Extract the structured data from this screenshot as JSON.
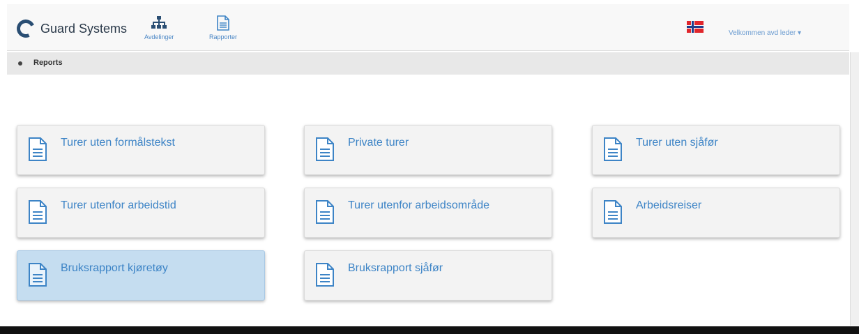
{
  "header": {
    "brand": "Guard Systems",
    "nav": [
      {
        "label": "Avdelinger",
        "icon": "org-chart-icon"
      },
      {
        "label": "Rapporter",
        "icon": "document-icon"
      }
    ],
    "language_flag": "norway-flag-icon",
    "welcome": "Velkommen avd leder"
  },
  "breadcrumb": {
    "label": "Reports"
  },
  "reports": [
    {
      "label": "Turer uten formålstekst"
    },
    {
      "label": "Private turer"
    },
    {
      "label": "Turer uten sjåfør"
    },
    {
      "label": "Turer utenfor arbeidstid"
    },
    {
      "label": "Turer utenfor arbeidsområde"
    },
    {
      "label": "Arbeidsreiser"
    },
    {
      "label": "Bruksrapport kjøretøy",
      "active": true
    },
    {
      "label": "Bruksrapport sjåfør"
    }
  ],
  "colors": {
    "accent": "#3d84c6",
    "active_card": "#c5ddf0",
    "brand_dark": "#2a4e73",
    "footer": "#111111"
  }
}
